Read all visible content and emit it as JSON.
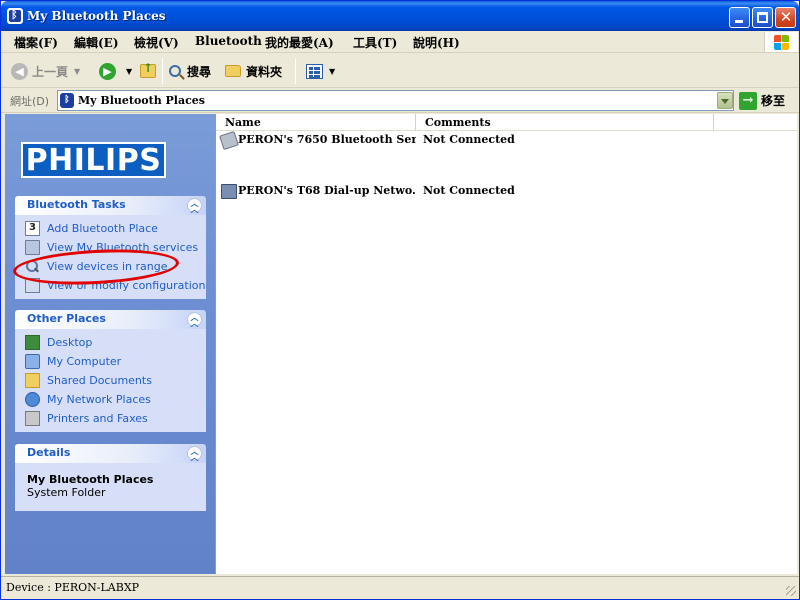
{
  "window": {
    "title": "My Bluetooth Places",
    "title_icon": "bluetooth-icon"
  },
  "menu": [
    {
      "label": "檔案(F)"
    },
    {
      "label": "編輯(E)"
    },
    {
      "label": "檢視(V)"
    },
    {
      "label": "Bluetooth"
    },
    {
      "label": "我的最愛(A)"
    },
    {
      "label": "工具(T)"
    },
    {
      "label": "說明(H)"
    }
  ],
  "toolbar": {
    "back_label": "上一頁",
    "search_label": "搜尋",
    "folders_label": "資料夾"
  },
  "address": {
    "label": "網址(D)",
    "value": "My Bluetooth Places",
    "go_label": "移至"
  },
  "sidebar": {
    "logo_text": "PHILIPS",
    "bluetooth_tasks": {
      "title": "Bluetooth Tasks",
      "items": [
        {
          "label": "Add Bluetooth Place",
          "icon": "add-place-icon"
        },
        {
          "label": "View My Bluetooth services",
          "icon": "laptop-icon"
        },
        {
          "label": "View devices in range",
          "icon": "search-icon"
        },
        {
          "label": "View or modify configuration",
          "icon": "configuration-icon"
        }
      ]
    },
    "other_places": {
      "title": "Other Places",
      "items": [
        {
          "label": "Desktop",
          "icon": "desktop-icon"
        },
        {
          "label": "My Computer",
          "icon": "computer-icon"
        },
        {
          "label": "Shared Documents",
          "icon": "folder-icon"
        },
        {
          "label": "My Network Places",
          "icon": "network-icon"
        },
        {
          "label": "Printers and Faxes",
          "icon": "printer-icon"
        }
      ]
    },
    "details": {
      "title": "Details",
      "name": "My Bluetooth Places",
      "type": "System Folder"
    }
  },
  "file_list": {
    "columns": [
      "Name",
      "Comments"
    ],
    "rows": [
      {
        "name": "PERON's 7650 Bluetooth Ser...",
        "comments": "Not Connected",
        "icon": "serial-port-icon"
      },
      {
        "name": "PERON's T68 Dial-up Netwo...",
        "comments": "Not Connected",
        "icon": "dialup-network-icon"
      }
    ]
  },
  "status": {
    "text": "Device : PERON-LABXP"
  },
  "colors": {
    "title_bar": "#0058e6",
    "task_pane": "#6d8ed2",
    "link": "#215dc6",
    "annotation": "#e00000"
  }
}
